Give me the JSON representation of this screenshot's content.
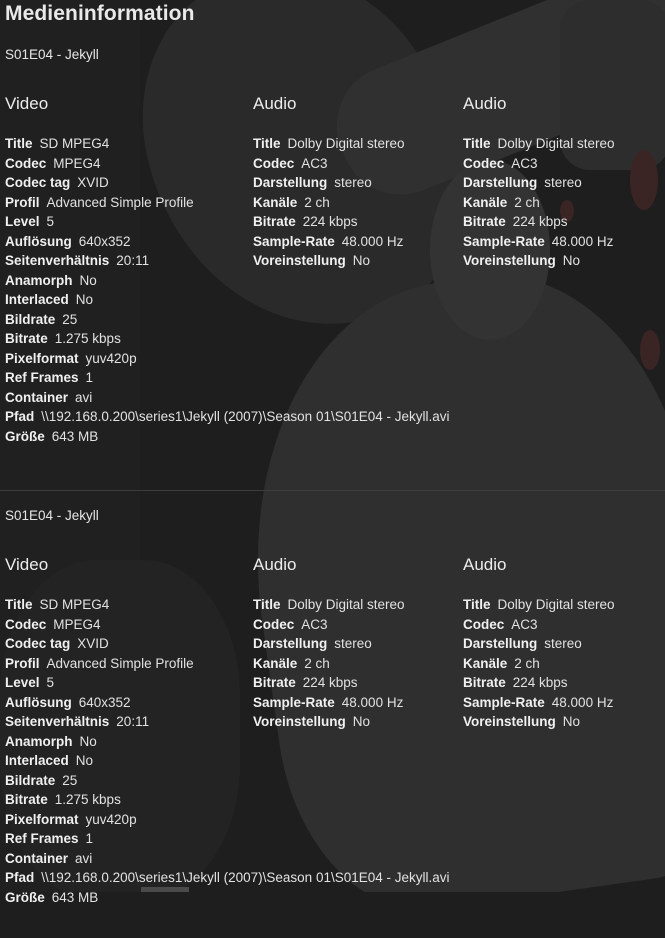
{
  "title": "Medieninformation",
  "sections": [
    {
      "file_name": "S01E04 - Jekyll",
      "video": {
        "heading": "Video",
        "rows": [
          {
            "k": "Title",
            "v": "SD MPEG4"
          },
          {
            "k": "Codec",
            "v": "MPEG4"
          },
          {
            "k": "Codec tag",
            "v": "XVID"
          },
          {
            "k": "Profil",
            "v": "Advanced Simple Profile"
          },
          {
            "k": "Level",
            "v": "5"
          },
          {
            "k": "Auflösung",
            "v": "640x352"
          },
          {
            "k": "Seitenverhältnis",
            "v": "20:11"
          },
          {
            "k": "Anamorph",
            "v": "No"
          },
          {
            "k": "Interlaced",
            "v": "No"
          },
          {
            "k": "Bildrate",
            "v": "25"
          },
          {
            "k": "Bitrate",
            "v": "1.275 kbps"
          },
          {
            "k": "Pixelformat",
            "v": "yuv420p"
          },
          {
            "k": "Ref Frames",
            "v": "1"
          },
          {
            "k": "Container",
            "v": "avi"
          },
          {
            "k": "Pfad",
            "v": "\\\\192.168.0.200\\series1\\Jekyll (2007)\\Season 01\\S01E04 - Jekyll.avi"
          },
          {
            "k": "Größe",
            "v": "643 MB"
          }
        ]
      },
      "audio": [
        {
          "heading": "Audio",
          "rows": [
            {
              "k": "Title",
              "v": "Dolby Digital stereo"
            },
            {
              "k": "Codec",
              "v": "AC3"
            },
            {
              "k": "Darstellung",
              "v": "stereo"
            },
            {
              "k": "Kanäle",
              "v": "2 ch"
            },
            {
              "k": "Bitrate",
              "v": "224 kbps"
            },
            {
              "k": "Sample-Rate",
              "v": "48.000 Hz"
            },
            {
              "k": "Voreinstellung",
              "v": "No"
            }
          ]
        },
        {
          "heading": "Audio",
          "rows": [
            {
              "k": "Title",
              "v": "Dolby Digital stereo"
            },
            {
              "k": "Codec",
              "v": "AC3"
            },
            {
              "k": "Darstellung",
              "v": "stereo"
            },
            {
              "k": "Kanäle",
              "v": "2 ch"
            },
            {
              "k": "Bitrate",
              "v": "224 kbps"
            },
            {
              "k": "Sample-Rate",
              "v": "48.000 Hz"
            },
            {
              "k": "Voreinstellung",
              "v": "No"
            }
          ]
        }
      ]
    },
    {
      "file_name": "S01E04 - Jekyll",
      "video": {
        "heading": "Video",
        "rows": [
          {
            "k": "Title",
            "v": "SD MPEG4"
          },
          {
            "k": "Codec",
            "v": "MPEG4"
          },
          {
            "k": "Codec tag",
            "v": "XVID"
          },
          {
            "k": "Profil",
            "v": "Advanced Simple Profile"
          },
          {
            "k": "Level",
            "v": "5"
          },
          {
            "k": "Auflösung",
            "v": "640x352"
          },
          {
            "k": "Seitenverhältnis",
            "v": "20:11"
          },
          {
            "k": "Anamorph",
            "v": "No"
          },
          {
            "k": "Interlaced",
            "v": "No"
          },
          {
            "k": "Bildrate",
            "v": "25"
          },
          {
            "k": "Bitrate",
            "v": "1.275 kbps"
          },
          {
            "k": "Pixelformat",
            "v": "yuv420p"
          },
          {
            "k": "Ref Frames",
            "v": "1"
          },
          {
            "k": "Container",
            "v": "avi"
          },
          {
            "k": "Pfad",
            "v": "\\\\192.168.0.200\\series1\\Jekyll (2007)\\Season 01\\S01E04 - Jekyll.avi"
          },
          {
            "k": "Größe",
            "v": "643 MB"
          }
        ]
      },
      "audio": [
        {
          "heading": "Audio",
          "rows": [
            {
              "k": "Title",
              "v": "Dolby Digital stereo"
            },
            {
              "k": "Codec",
              "v": "AC3"
            },
            {
              "k": "Darstellung",
              "v": "stereo"
            },
            {
              "k": "Kanäle",
              "v": "2 ch"
            },
            {
              "k": "Bitrate",
              "v": "224 kbps"
            },
            {
              "k": "Sample-Rate",
              "v": "48.000 Hz"
            },
            {
              "k": "Voreinstellung",
              "v": "No"
            }
          ]
        },
        {
          "heading": "Audio",
          "rows": [
            {
              "k": "Title",
              "v": "Dolby Digital stereo"
            },
            {
              "k": "Codec",
              "v": "AC3"
            },
            {
              "k": "Darstellung",
              "v": "stereo"
            },
            {
              "k": "Kanäle",
              "v": "2 ch"
            },
            {
              "k": "Bitrate",
              "v": "224 kbps"
            },
            {
              "k": "Sample-Rate",
              "v": "48.000 Hz"
            },
            {
              "k": "Voreinstellung",
              "v": "No"
            }
          ]
        }
      ]
    }
  ],
  "colors": {
    "background": "#1e1e1e",
    "text": "#e6e6e6",
    "divider": "#3d3d3d"
  }
}
